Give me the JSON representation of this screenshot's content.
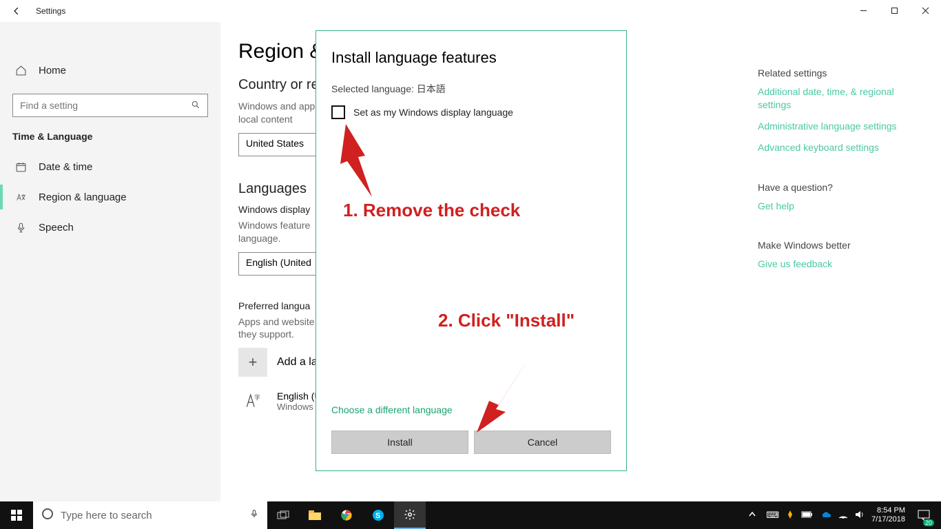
{
  "titlebar": {
    "title": "Settings"
  },
  "sidebar": {
    "home": "Home",
    "search_placeholder": "Find a setting",
    "group": "Time & Language",
    "items": [
      {
        "label": "Date & time"
      },
      {
        "label": "Region & language"
      },
      {
        "label": "Speech"
      }
    ]
  },
  "main": {
    "h1": "Region & ",
    "country_head": "Country or re",
    "country_desc": "Windows and app\nlocal content",
    "country_value": "United States",
    "lang_head": "Languages",
    "disp_label": "Windows display",
    "disp_desc": "Windows feature\nlanguage.",
    "disp_value": "English (United",
    "pref_label": "Preferred langua",
    "pref_desc": "Apps and website\nthey support.",
    "add_lang": "Add a lan",
    "lang_name": "English (U",
    "lang_sub": "Windows "
  },
  "rightcol": {
    "related_head": "Related settings",
    "links": [
      "Additional date, time, & regional settings",
      "Administrative language settings",
      "Advanced keyboard settings"
    ],
    "q_head": "Have a question?",
    "q_link": "Get help",
    "better_head": "Make Windows better",
    "better_link": "Give us feedback"
  },
  "dialog": {
    "title": "Install language features",
    "selected": "Selected language: 日本語",
    "checkbox_label": "Set as my Windows display language",
    "choose": "Choose a different language",
    "install": "Install",
    "cancel": "Cancel"
  },
  "annotations": {
    "a1": "1. Remove the check",
    "a2": "2. Click \"Install\""
  },
  "taskbar": {
    "search_placeholder": "Type here to search",
    "time": "8:54 PM",
    "date": "7/17/2018",
    "notif_count": "20"
  }
}
